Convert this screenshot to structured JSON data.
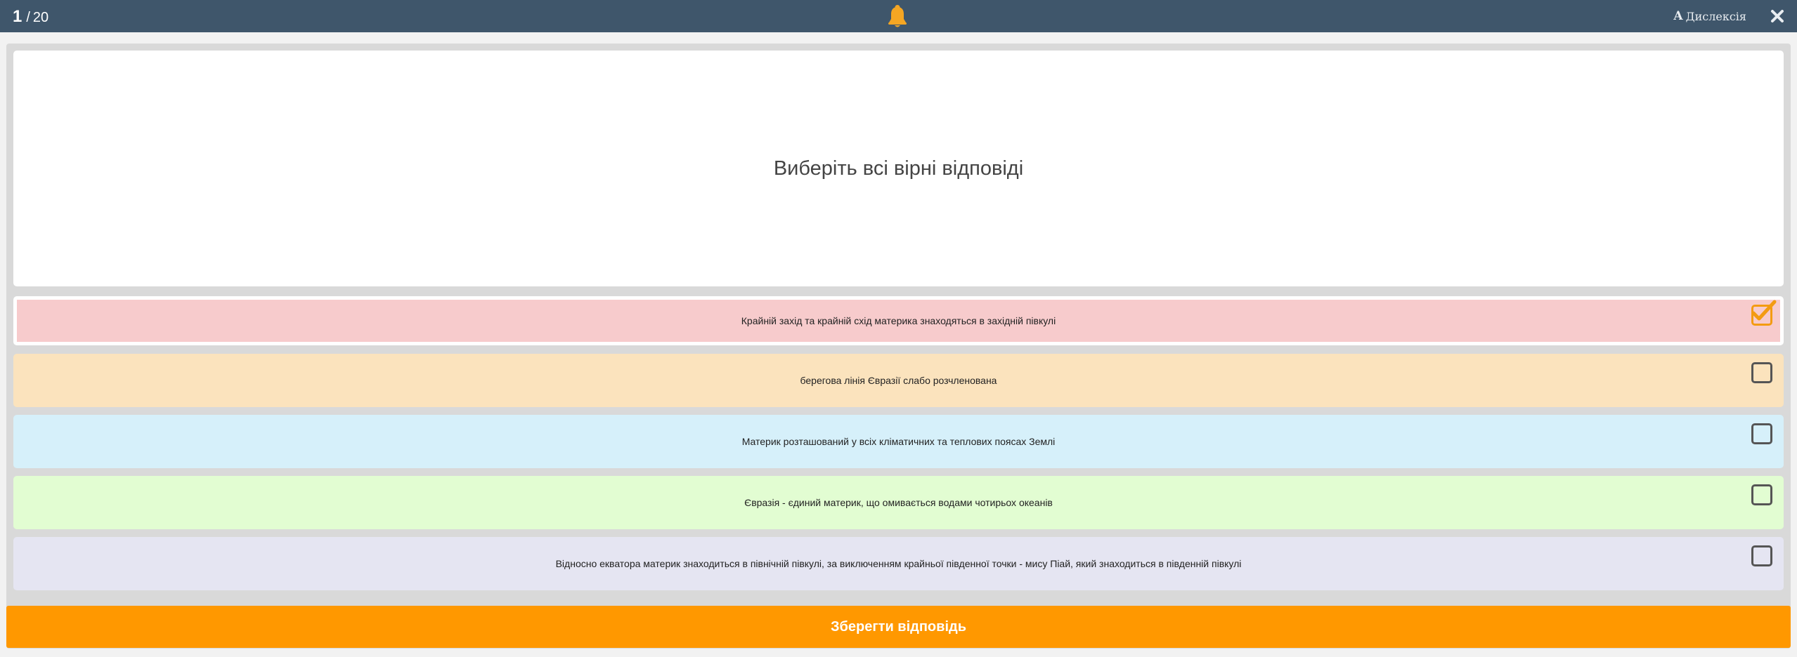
{
  "header": {
    "current": "1",
    "separator": "/",
    "total": "20",
    "dyslexia_glyph": "A",
    "dyslexia_label": "Дислексія",
    "icons": {
      "bell": "bell-icon",
      "close": "close-icon"
    }
  },
  "question": {
    "text": "Виберіть всі вірні відповіді"
  },
  "answers": [
    {
      "text": "Крайній захід та крайній схід материка знаходяться в західній півкулі",
      "selected": true,
      "color": "#f7cbcc"
    },
    {
      "text": "берегова лінія Євразії слабо розчленована",
      "selected": false,
      "color": "#fbe3bd"
    },
    {
      "text": "Материк розташований у всіх кліматичних та теплових поясах Землі",
      "selected": false,
      "color": "#d6f0fa"
    },
    {
      "text": "Євразія - єдиний материк, що омивається водами чотирьох океанів",
      "selected": false,
      "color": "#e2fdd2"
    },
    {
      "text": "Відносно екватора материк знаходиться в північній півкулі, за виключенням крайньої південної точки - мису Піай, який знаходиться в південній півкулі",
      "selected": false,
      "color": "#e5e5f2"
    }
  ],
  "save_button": {
    "label": "Зберегти відповідь",
    "color": "#ff9800"
  },
  "colors": {
    "topbar": "#3f566b",
    "accent": "#f39b12"
  }
}
